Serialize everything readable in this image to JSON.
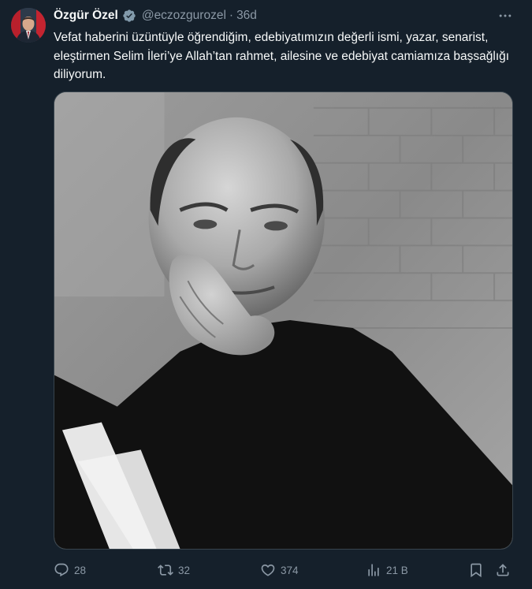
{
  "author": {
    "display_name": "Özgür Özel",
    "handle": "@eczozgurozel",
    "separator": "·",
    "time": "36d",
    "verified_color": "#829aab"
  },
  "tweet": {
    "text": "Vefat haberini üzüntüyle öğrendiğim, edebiyatımızın değerli ismi, yazar, senarist, eleştirmen Selim İleri’ye Allah’tan rahmet, ailesine ve edebiyat camiamıza başsağlığı diliyorum."
  },
  "actions": {
    "replies": "28",
    "retweets": "32",
    "likes": "374",
    "views": "21 B"
  },
  "icons": {
    "more": "more-horizontal-icon",
    "reply": "reply-icon",
    "retweet": "retweet-icon",
    "like": "heart-icon",
    "views": "views-chart-icon",
    "bookmark": "bookmark-icon",
    "share": "share-icon"
  },
  "colors": {
    "background": "#15202b",
    "text_primary": "#f7f9f9",
    "text_secondary": "#8b98a5",
    "border": "#38444d"
  }
}
